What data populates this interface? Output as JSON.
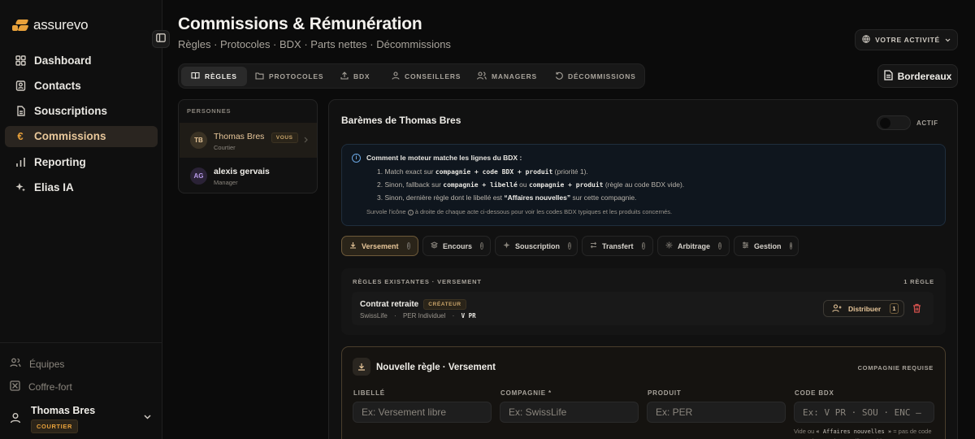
{
  "app": {
    "logo": "assurevo"
  },
  "sidebar": {
    "items": [
      {
        "label": "Dashboard",
        "icon": "grid-icon"
      },
      {
        "label": "Contacts",
        "icon": "contacts-icon"
      },
      {
        "label": "Souscriptions",
        "icon": "document-icon"
      },
      {
        "label": "Commissions",
        "icon": "euro-icon",
        "active": true
      },
      {
        "label": "Reporting",
        "icon": "chart-icon"
      },
      {
        "label": "Elias IA",
        "icon": "sparkle-icon"
      }
    ],
    "secondary": [
      {
        "label": "Équipes",
        "icon": "team-icon"
      },
      {
        "label": "Coffre-fort",
        "icon": "vault-icon"
      }
    ],
    "user": {
      "name": "Thomas Bres",
      "role": "COURTIER"
    }
  },
  "header": {
    "title": "Commissions & Rémunération",
    "subtitle": "Règles · Protocoles · BDX · Parts nettes · Décommissions",
    "activity_label": "VOTRE ACTIVITÉ",
    "bordereaux_label": "Bordereaux"
  },
  "tabs": [
    {
      "label": "RÈGLES",
      "active": true
    },
    {
      "label": "PROTOCOLES"
    },
    {
      "label": "BDX"
    },
    {
      "label": "CONSEILLERS"
    },
    {
      "label": "MANAGERS"
    },
    {
      "label": "DÉCOMMISSIONS"
    }
  ],
  "people": {
    "heading": "PERSONNES",
    "list": [
      {
        "initials": "TB",
        "name": "Thomas Bres",
        "badge": "VOUS",
        "role": "Courtier",
        "active": true
      },
      {
        "initials": "AG",
        "name": "alexis gervais",
        "role": "Manager"
      }
    ]
  },
  "main": {
    "title": "Barèmes de Thomas Bres",
    "toggle_label": "ACTIF",
    "info": {
      "heading": "Comment le moteur matche les lignes du BDX :",
      "line1": {
        "a": "1. Match exact sur ",
        "code": "compagnie + code BDX + produit",
        "b": " (priorité 1)."
      },
      "line2": {
        "a": "2. Sinon, fallback sur ",
        "code1": "compagnie + libellé",
        "mid": " ou ",
        "code2": "compagnie + produit",
        "b": " (règle au code BDX vide)."
      },
      "line3": {
        "a": "3. Sinon, dernière règle dont le libellé est ",
        "strong": "“Affaires nouvelles”",
        "b": " sur cette compagnie."
      },
      "footer": {
        "a": "Survole l'icône ",
        "b": " à droite de chaque acte ci-dessous pour voir les codes BDX typiques et les produits concernés."
      }
    },
    "types": [
      {
        "label": "Versement",
        "active": true
      },
      {
        "label": "Encours"
      },
      {
        "label": "Souscription"
      },
      {
        "label": "Transfert"
      },
      {
        "label": "Arbitrage"
      },
      {
        "label": "Gestion"
      }
    ],
    "existing": {
      "heading": "RÈGLES EXISTANTES · VERSEMENT",
      "count": "1 RÈGLE",
      "rule": {
        "name": "Contrat retraite",
        "badge": "CRÉATEUR",
        "company": "SwissLife",
        "product": "PER Individuel",
        "code": "V PR",
        "distribute_label": "Distribuer",
        "distribute_count": "1"
      }
    },
    "new_rule": {
      "title": "Nouvelle règle · Versement",
      "required_note": "COMPAGNIE REQUISE",
      "fields": {
        "libelle": {
          "label": "LIBELLÉ",
          "placeholder": "Ex: Versement libre"
        },
        "compagnie": {
          "label": "COMPAGNIE *",
          "placeholder": "Ex: SwissLife"
        },
        "produit": {
          "label": "PRODUIT",
          "placeholder": "Ex: PER"
        },
        "code_bdx": {
          "label": "CODE BDX",
          "placeholder": "Ex: V PR · SOU · ENC — vide"
        }
      },
      "hint": {
        "a": "Vide ou ",
        "code": "« Affaires nouvelles »",
        "b": " = pas de code en sur le BDX (Generali), matching par"
      }
    }
  }
}
